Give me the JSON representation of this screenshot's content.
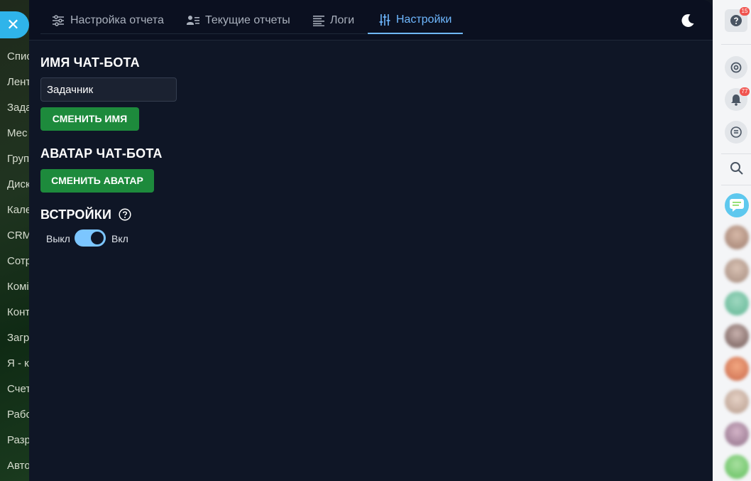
{
  "background_menu": {
    "items": [
      "Спис",
      "Лент",
      "Зада",
      "Мес",
      "Груп",
      "Диск",
      "Кале",
      "CRM",
      "Сотр",
      "Комі",
      "Конт",
      "Загр",
      "Я - к",
      "Счет",
      "Рабо",
      "Разр",
      "Авто"
    ]
  },
  "close_button": {
    "icon": "close-icon",
    "glyph": "✕"
  },
  "tabs": [
    {
      "label": "Настройка отчета",
      "icon": "sliders-icon"
    },
    {
      "label": "Текущие отчеты",
      "icon": "user-list-icon"
    },
    {
      "label": "Логи",
      "icon": "log-lines-icon"
    },
    {
      "label": "Настройки",
      "icon": "settings-sliders-icon",
      "active": true
    }
  ],
  "theme_toggle": {
    "icon": "moon-icon"
  },
  "bot_name": {
    "title": "ИМЯ ЧАТ-БОТА",
    "input_value": "Задачник",
    "button_label": "СМЕНИТЬ ИМЯ"
  },
  "bot_avatar": {
    "title": "АВАТАР ЧАТ-БОТА",
    "button_label": "СМЕНИТЬ АВАТАР"
  },
  "embeds": {
    "title": "ВСТРОЙКИ",
    "help_icon": "help-circle-icon",
    "toggle_off_label": "Выкл",
    "toggle_on_label": "Вкл",
    "enabled": true
  },
  "right_sidebar": {
    "help_badge": "15",
    "notifications_badge": "77",
    "icons": [
      "help-icon",
      "refresh-icon",
      "bell-icon",
      "chat-search-icon",
      "search-icon"
    ]
  },
  "colors": {
    "accent": "#6fb8ff",
    "button_green": "#1d8a3c",
    "panel_bg": "#0f1626",
    "badge_red": "#f0544f"
  }
}
